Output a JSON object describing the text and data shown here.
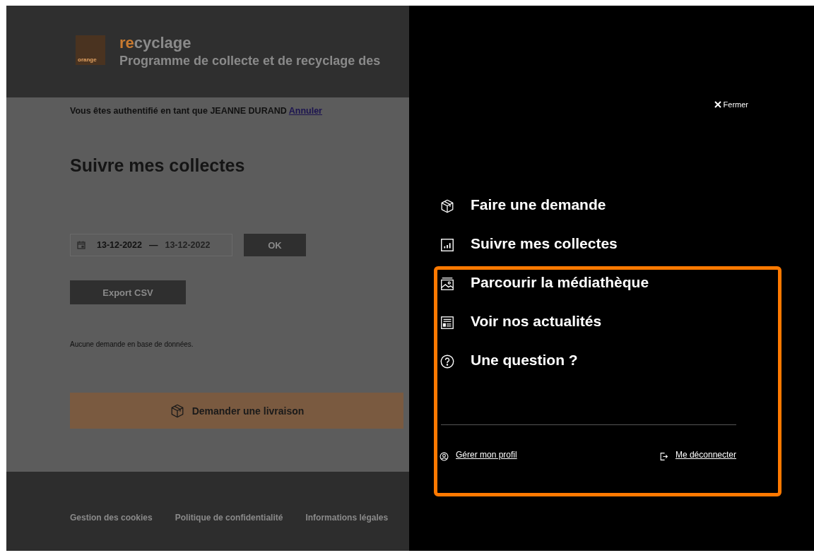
{
  "header": {
    "logo_text": "orange",
    "brand_accent": "re",
    "brand_rest": "cyclage",
    "subtitle": "Programme de collecte et de recyclage des"
  },
  "auth_notice": {
    "text": "Vous êtes authentifié en tant que JEANNE DURAND",
    "link": "Annuler"
  },
  "page_title": "Suivre mes collectes",
  "date_range": {
    "start": "13-12-2022",
    "separator": "—",
    "end": "13-12-2022"
  },
  "ok_button": "OK",
  "export_button": "Export CSV",
  "empty_message": "Aucune demande en base de données.",
  "delivery_button": "Demander une livraison",
  "footer_links": [
    "Gestion des cookies",
    "Politique de confidentialité",
    "Informations légales"
  ],
  "menu": {
    "close_label": "Fermer",
    "items": [
      {
        "label": "Faire une demande",
        "kind": "box"
      },
      {
        "label": "Suivre mes collectes",
        "kind": "chart"
      },
      {
        "label": "Parcourir la médiathèque",
        "kind": "image"
      },
      {
        "label": "Voir nos actualités",
        "kind": "news"
      },
      {
        "label": "Une question ?",
        "kind": "question"
      }
    ],
    "bottom_links": [
      {
        "label": "Gérer mon profil",
        "kind": "user"
      },
      {
        "label": "Me déconnecter",
        "kind": "logout"
      }
    ]
  },
  "highlight": {
    "color": "#ff7900"
  }
}
